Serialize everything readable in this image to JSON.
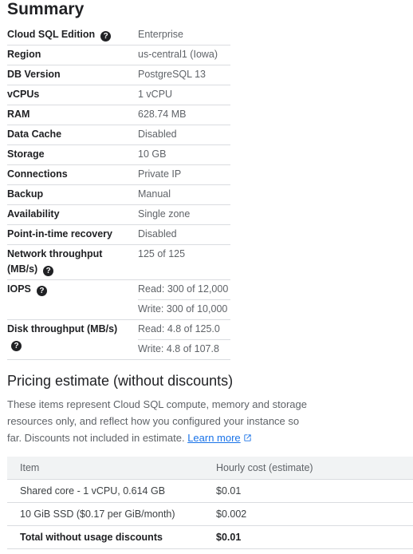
{
  "summary": {
    "title": "Summary",
    "rows": [
      {
        "label": "Cloud SQL Edition",
        "value": "Enterprise",
        "help": true
      },
      {
        "label": "Region",
        "value": "us-central1 (Iowa)"
      },
      {
        "label": "DB Version",
        "value": "PostgreSQL 13"
      },
      {
        "label": "vCPUs",
        "value": "1 vCPU"
      },
      {
        "label": "RAM",
        "value": "628.74 MB"
      },
      {
        "label": "Data Cache",
        "value": "Disabled"
      },
      {
        "label": "Storage",
        "value": "10 GB"
      },
      {
        "label": "Connections",
        "value": "Private IP"
      },
      {
        "label": "Backup",
        "value": "Manual"
      },
      {
        "label": "Availability",
        "value": "Single zone"
      },
      {
        "label": "Point-in-time recovery",
        "value": "Disabled"
      },
      {
        "label": "Network throughput (MB/s)",
        "value": "125 of 125",
        "help": true
      },
      {
        "label": "IOPS",
        "values": [
          "Read: 300 of 12,000",
          "Write: 300 of 10,000"
        ],
        "help": true
      },
      {
        "label": "Disk throughput (MB/s)",
        "values": [
          "Read: 4.8 of 125.0",
          "Write: 4.8 of 107.8"
        ],
        "help": true
      }
    ]
  },
  "pricing": {
    "title": "Pricing estimate (without discounts)",
    "description": "These items represent Cloud SQL compute, memory and storage resources only, and reflect how you configured your instance so far. Discounts not included in estimate.",
    "learn_more": "Learn more",
    "headers": {
      "item": "Item",
      "cost": "Hourly cost (estimate)"
    },
    "rows": [
      {
        "item": "Shared core - 1 vCPU, 0.614 GB",
        "cost": "$0.01"
      },
      {
        "item": "10 GiB SSD ($0.17 per GiB/month)",
        "cost": "$0.002"
      }
    ],
    "total": {
      "item": "Total without usage discounts",
      "cost": "$0.01"
    }
  }
}
